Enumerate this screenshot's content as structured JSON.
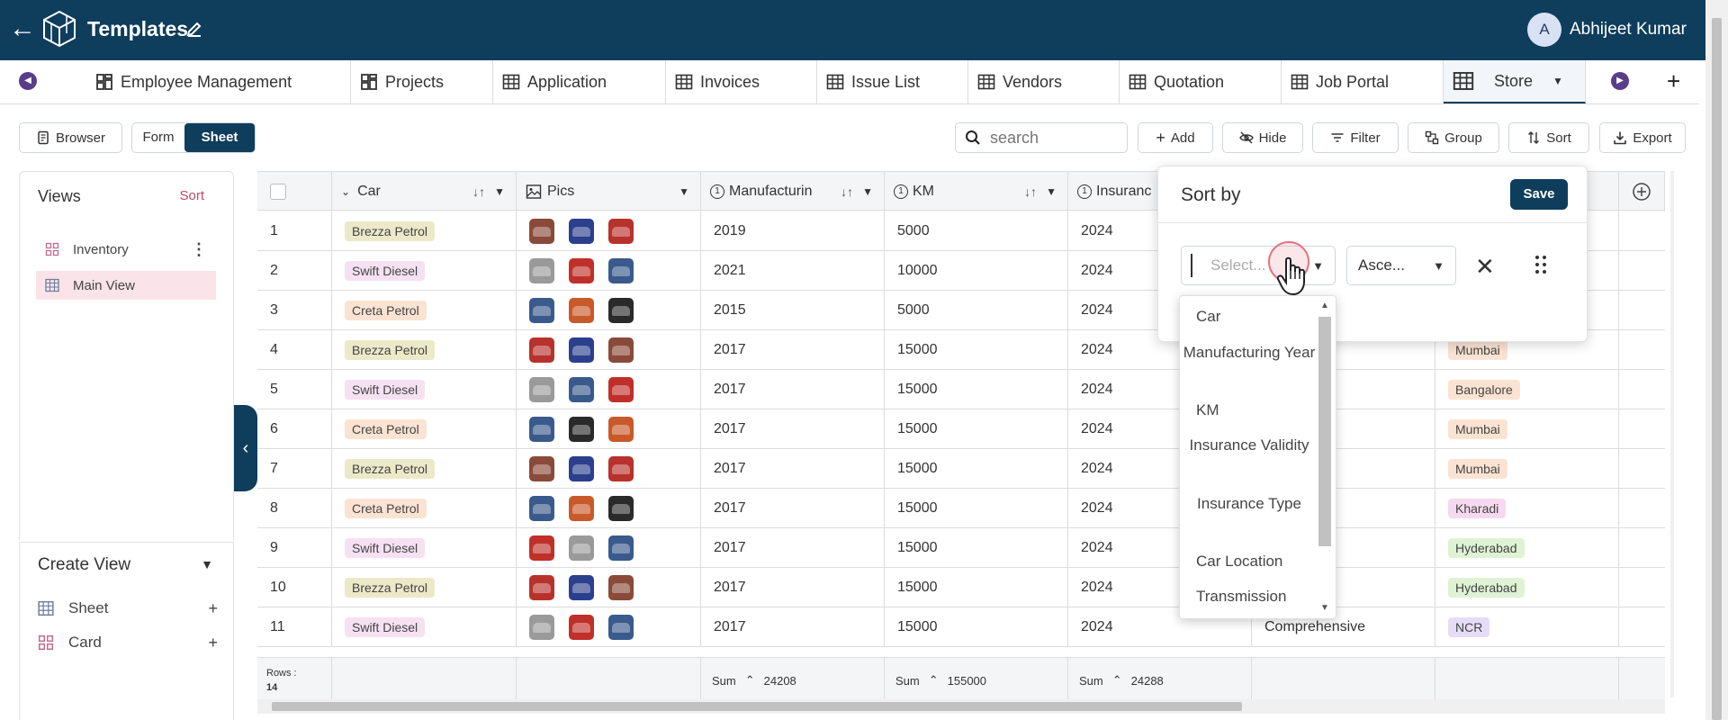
{
  "header": {
    "title": "Templates",
    "user_initial": "A",
    "user_name": "Abhijeet Kumar"
  },
  "tabs": [
    {
      "label": "Employee Management",
      "icon": "dashboard-icon"
    },
    {
      "label": "Projects",
      "icon": "dashboard-icon"
    },
    {
      "label": "Application",
      "icon": "table-icon"
    },
    {
      "label": "Invoices",
      "icon": "table-icon"
    },
    {
      "label": "Issue List",
      "icon": "table-icon"
    },
    {
      "label": "Vendors",
      "icon": "table-icon"
    },
    {
      "label": "Quotation",
      "icon": "table-icon"
    },
    {
      "label": "Job Portal",
      "icon": "table-icon"
    },
    {
      "label": "Store",
      "icon": "table-icon",
      "active": true
    }
  ],
  "toolbar": {
    "browser": "Browser",
    "form": "Form",
    "sheet": "Sheet",
    "search_placeholder": "search",
    "add": "Add",
    "hide": "Hide",
    "filter": "Filter",
    "group": "Group",
    "sort": "Sort",
    "export": "Export"
  },
  "views": {
    "title": "Views",
    "sort": "Sort",
    "items": [
      {
        "label": "Inventory",
        "icon": "card-icon"
      },
      {
        "label": "Main View",
        "icon": "table-icon",
        "active": true
      }
    ]
  },
  "create_view": {
    "title": "Create View",
    "items": [
      {
        "label": "Sheet",
        "icon": "table-icon"
      },
      {
        "label": "Card",
        "icon": "card-icon"
      }
    ]
  },
  "grid": {
    "columns": [
      "Car",
      "Pics",
      "Manufacturin",
      "KM",
      "Insuranc"
    ],
    "rows": [
      {
        "n": "1",
        "car": "Brezza Petrol",
        "year": "2019",
        "km": "5000",
        "ins": "2024",
        "type": "",
        "loc": ""
      },
      {
        "n": "2",
        "car": "Swift Diesel",
        "year": "2021",
        "km": "10000",
        "ins": "2024",
        "type": "",
        "loc": ""
      },
      {
        "n": "3",
        "car": "Creta Petrol",
        "year": "2015",
        "km": "5000",
        "ins": "2024",
        "type": "",
        "loc": ""
      },
      {
        "n": "4",
        "car": "Brezza Petrol",
        "year": "2017",
        "km": "15000",
        "ins": "2024",
        "type": "sive",
        "loc": "Mumbai"
      },
      {
        "n": "5",
        "car": "Swift Diesel",
        "year": "2017",
        "km": "15000",
        "ins": "2024",
        "type": "sive",
        "loc": "Bangalore"
      },
      {
        "n": "6",
        "car": "Creta Petrol",
        "year": "2017",
        "km": "15000",
        "ins": "2024",
        "type": "sive",
        "loc": "Mumbai"
      },
      {
        "n": "7",
        "car": "Brezza Petrol",
        "year": "2017",
        "km": "15000",
        "ins": "2024",
        "type": "sive",
        "loc": "Mumbai"
      },
      {
        "n": "8",
        "car": "Creta Petrol",
        "year": "2017",
        "km": "15000",
        "ins": "2024",
        "type": "sive",
        "loc": "Kharadi"
      },
      {
        "n": "9",
        "car": "Swift Diesel",
        "year": "2017",
        "km": "15000",
        "ins": "2024",
        "type": "sive",
        "loc": "Hyderabad"
      },
      {
        "n": "10",
        "car": "Brezza Petrol",
        "year": "2017",
        "km": "15000",
        "ins": "2024",
        "type": "sive",
        "loc": "Hyderabad"
      },
      {
        "n": "11",
        "car": "Swift Diesel",
        "year": "2017",
        "km": "15000",
        "ins": "2024",
        "type": "Comprehensive",
        "loc": "NCR"
      }
    ],
    "footer": {
      "rows_label": "Rows :",
      "rows_count": "14",
      "sum_label": "Sum",
      "sum_year": "24208",
      "sum_km": "155000",
      "sum_ins": "24288"
    }
  },
  "sort_popup": {
    "title": "Sort by",
    "save": "Save",
    "field_placeholder": "Select...",
    "order_value": "Asce...",
    "options": [
      "Car",
      "Manufacturing Year",
      "KM",
      "Insurance Validity",
      "Insurance Type",
      "Car Location",
      "Transmission"
    ]
  },
  "colors": {
    "brand": "#0f3d5c",
    "accent_pink": "#c04a6b",
    "tag_brezza": "#ece9c9",
    "tag_swift": "#f6e1f2",
    "tag_creta": "#fbe3d3",
    "loc_mumbai": "#fbe3d3",
    "loc_bangalore": "#fbe3d3",
    "loc_kharadi": "#f6d9f0",
    "loc_hyderabad": "#dff3d4",
    "loc_ncr": "#e7dcf6"
  }
}
